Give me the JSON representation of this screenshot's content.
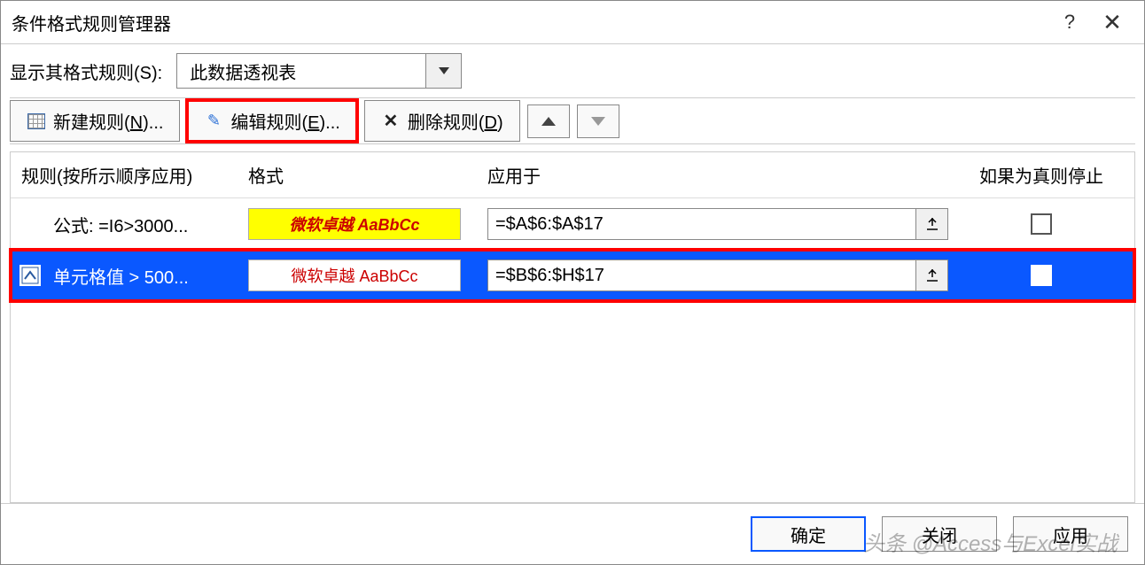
{
  "titlebar": {
    "title": "条件格式规则管理器"
  },
  "show_rules_label": "显示其格式规则(S):",
  "scope_select": {
    "value": "此数据透视表"
  },
  "toolbar": {
    "new_rule": "新建规则(N)...",
    "edit_rule": "编辑规则(E)...",
    "delete_rule": "删除规则(D)"
  },
  "columns": {
    "rule": "规则(按所示顺序应用)",
    "format": "格式",
    "applies_to": "应用于",
    "stop_if_true": "如果为真则停止"
  },
  "rows": [
    {
      "rule": "公式: =I6>3000...",
      "preview": "微软卓越 AaBbCc",
      "applies_to": "=$A$6:$A$17"
    },
    {
      "rule": "单元格值 > 500...",
      "preview": "微软卓越 AaBbCc",
      "applies_to": "=$B$6:$H$17"
    }
  ],
  "footer": {
    "ok": "确定",
    "close": "关闭",
    "apply": "应用"
  },
  "watermark": "头条 @Access与Excel实战"
}
